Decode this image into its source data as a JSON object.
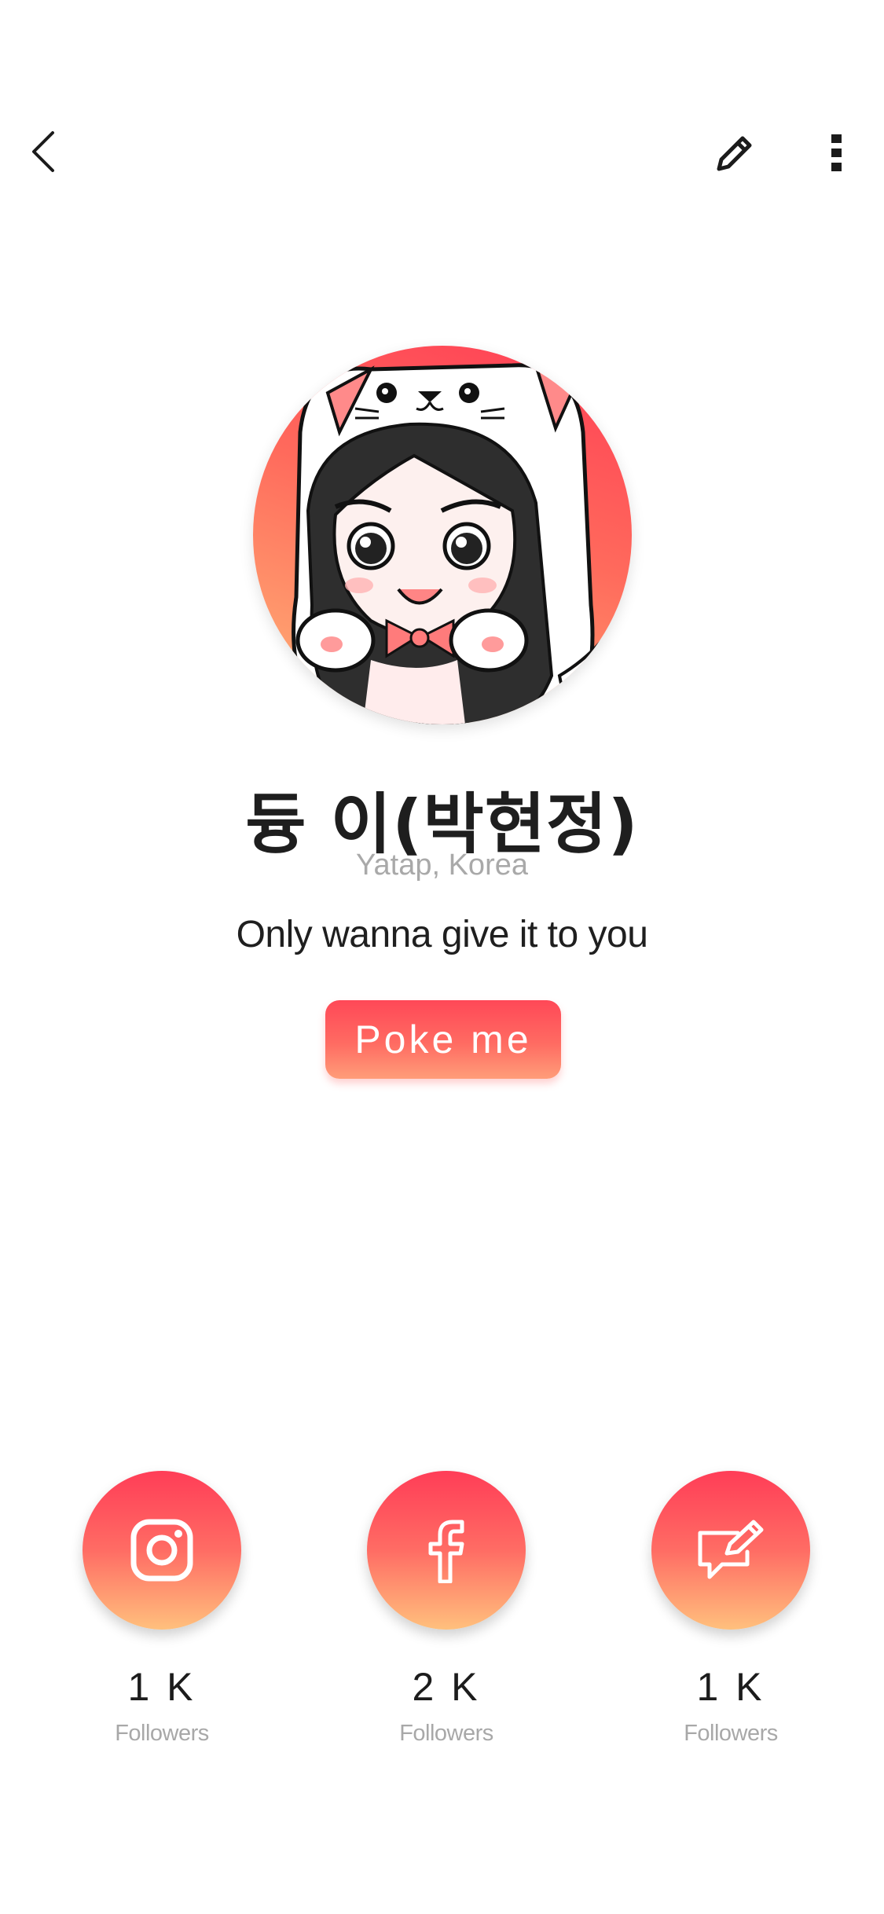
{
  "header": {
    "back_icon": "chevron-left-icon",
    "edit_icon": "pencil-icon",
    "more_icon": "more-vertical-icon"
  },
  "profile": {
    "avatar": "cat-hood-girl-cartoon",
    "name": "듕 이(박현정)",
    "location": "Yatap, Korea",
    "bio": "Only wanna give it to you"
  },
  "poke_button": {
    "label": "Poke me"
  },
  "social": [
    {
      "icon": "instagram-icon",
      "count": "1 K",
      "label": "Followers"
    },
    {
      "icon": "facebook-icon",
      "count": "2 K",
      "label": "Followers"
    },
    {
      "icon": "blog-edit-icon",
      "count": "1 K",
      "label": "Followers"
    }
  ],
  "colors": {
    "accent_top": "#ff3d55",
    "accent_bottom": "#ffb677",
    "muted_text": "#a9a9a9"
  }
}
